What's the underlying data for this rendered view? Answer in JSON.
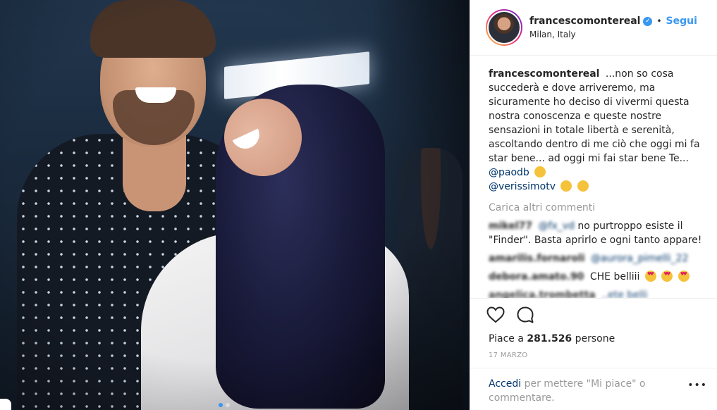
{
  "header": {
    "username": "francescomontereal",
    "follow_label": "Segui",
    "location": "Milan, Italy",
    "separator": "•"
  },
  "caption": {
    "username": "francescomontereal",
    "text": "...non so cosa succederà e dove arriveremo, ma sicuramente ho deciso di vivermi questa nostra conoscenza e queste nostre sensazioni in totale libertà e serenità, ascoltando dentro di me ciò che oggi mi fa star bene... ad oggi mi fai star bene Te...",
    "mention_1": "@paodb",
    "mention_2": "@verissimotv"
  },
  "load_more_label": "Carica altri commenti",
  "comments": [
    {
      "username": "mikel77",
      "mention": "@fx_vd",
      "text": "no purtroppo esiste il \"Finder\". Basta aprirlo e ogni tanto appare!"
    },
    {
      "username": "amarilis.fornaroli",
      "mention": "@aurora_pimelli_22",
      "text": ""
    },
    {
      "username": "debora.amato.90",
      "mention": "",
      "text": "CHE belliii"
    },
    {
      "username": "angelica.trombetta",
      "mention": "",
      "text": "..ete belli"
    }
  ],
  "likes": {
    "prefix": "Piace a",
    "count": "281.526",
    "suffix": "persone"
  },
  "date": "17 MARZO",
  "login": {
    "link": "Accedi",
    "text": "per mettere \"Mi piace\" o commentare."
  },
  "more_label": "•••",
  "icons": [
    "heart-icon",
    "comment-icon",
    "verified-icon",
    "more-icon"
  ],
  "colors": {
    "accent": "#3897f0",
    "link": "#003569",
    "muted": "#999999"
  },
  "carousel": {
    "count": 2,
    "active": 1
  }
}
